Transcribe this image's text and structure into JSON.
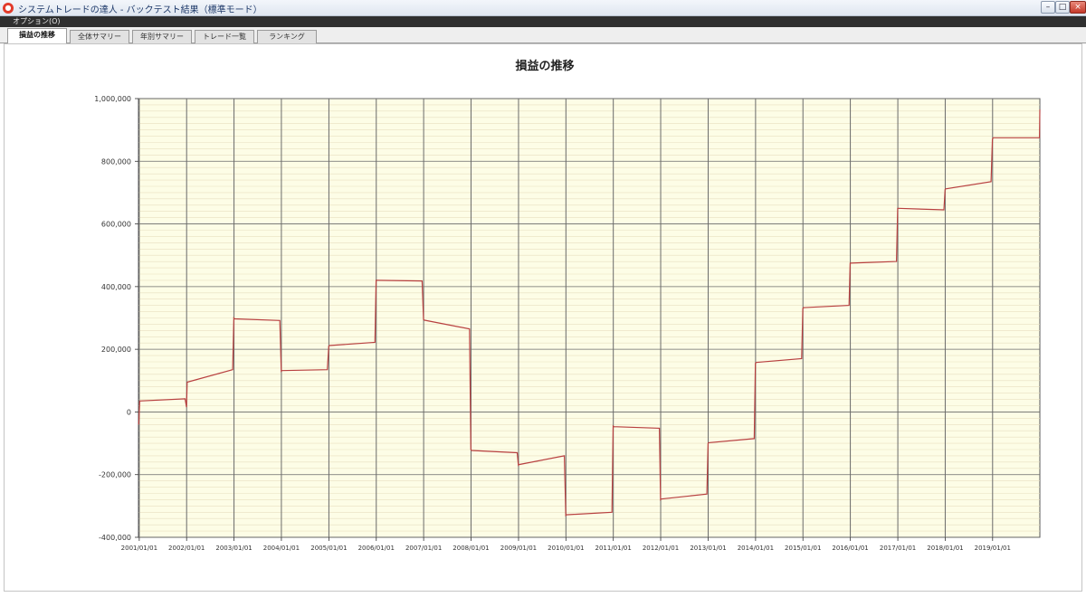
{
  "window": {
    "title": "システムトレードの達人 - バックテスト結果（標準モード）",
    "app_icon": "app-logo-icon",
    "buttons": {
      "minimize": "–",
      "maximize": "□",
      "close": "×"
    }
  },
  "menu": {
    "items": [
      "オプション(O)"
    ]
  },
  "tabs": [
    {
      "label": "損益の推移",
      "active": true
    },
    {
      "label": "全体サマリー",
      "active": false
    },
    {
      "label": "年別サマリー",
      "active": false
    },
    {
      "label": "トレード一覧",
      "active": false
    },
    {
      "label": "ランキング",
      "active": false
    }
  ],
  "colors": {
    "plot_background": "#fdfde6",
    "line": "#b84040",
    "major_grid": "#6a6a6a",
    "minor_grid": "#e8e0c0"
  },
  "chart_data": {
    "type": "line",
    "title": "損益の推移",
    "xlabel": "",
    "ylabel": "",
    "ylim": [
      -400000,
      1000000
    ],
    "yticks": [
      "1,000,000",
      "800,000",
      "600,000",
      "400,000",
      "200,000",
      "0",
      "-200,000",
      "-400,000"
    ],
    "ytick_values": [
      1000000,
      800000,
      600000,
      400000,
      200000,
      0,
      -200000,
      -400000
    ],
    "xticks": [
      "2001/01/01",
      "2002/01/01",
      "2003/01/01",
      "2004/01/01",
      "2005/01/01",
      "2006/01/01",
      "2007/01/01",
      "2008/01/01",
      "2009/01/01",
      "2010/01/01",
      "2011/01/01",
      "2012/01/01",
      "2013/01/01",
      "2014/01/01",
      "2015/01/01",
      "2016/01/01",
      "2017/01/01",
      "2018/01/01",
      "2019/01/01"
    ],
    "xlim": [
      "2000-12-26",
      "2019-12-31"
    ],
    "grid": true,
    "series": [
      {
        "x": [
          "2000-12-28",
          "2001-01-05",
          "2001-12-20",
          "2001-12-31",
          "2002-01-05",
          "2002-12-22",
          "2002-12-31",
          "2003-01-06",
          "2003-12-20",
          "2003-12-31",
          "2004-01-05",
          "2004-12-20",
          "2004-12-31",
          "2005-01-05",
          "2005-12-22",
          "2005-12-31",
          "2006-01-06",
          "2006-12-20",
          "2006-12-31",
          "2007-01-05",
          "2007-12-20",
          "2007-12-31",
          "2008-01-05",
          "2008-12-22",
          "2008-12-31",
          "2009-01-05",
          "2009-12-20",
          "2009-12-31",
          "2010-01-05",
          "2010-12-22",
          "2010-12-31",
          "2011-01-05",
          "2011-12-22",
          "2011-12-31",
          "2012-01-05",
          "2012-12-22",
          "2012-12-31",
          "2013-01-05",
          "2013-12-22",
          "2013-12-31",
          "2014-01-05",
          "2014-12-22",
          "2014-12-31",
          "2015-01-05",
          "2015-12-22",
          "2015-12-31",
          "2016-01-05",
          "2016-12-22",
          "2016-12-31",
          "2017-01-05",
          "2017-12-22",
          "2017-12-31",
          "2018-01-05",
          "2018-12-20",
          "2018-12-31",
          "2019-01-05",
          "2019-12-28",
          "2019-12-31"
        ],
        "y": [
          -40000,
          35000,
          42000,
          15000,
          95000,
          135000,
          300000,
          297000,
          292000,
          130000,
          132000,
          135000,
          210000,
          212000,
          222000,
          420000,
          420000,
          418000,
          295000,
          293000,
          265000,
          -120000,
          -123000,
          -130000,
          -170000,
          -168000,
          -140000,
          -330000,
          -328000,
          -320000,
          -45000,
          -47000,
          -52000,
          -280000,
          -278000,
          -262000,
          -100000,
          -98000,
          -85000,
          155000,
          158000,
          170000,
          330000,
          333000,
          340000,
          475000,
          475000,
          480000,
          650000,
          650000,
          645000,
          710000,
          712000,
          735000,
          870000,
          875000,
          875000,
          965000
        ]
      }
    ]
  }
}
